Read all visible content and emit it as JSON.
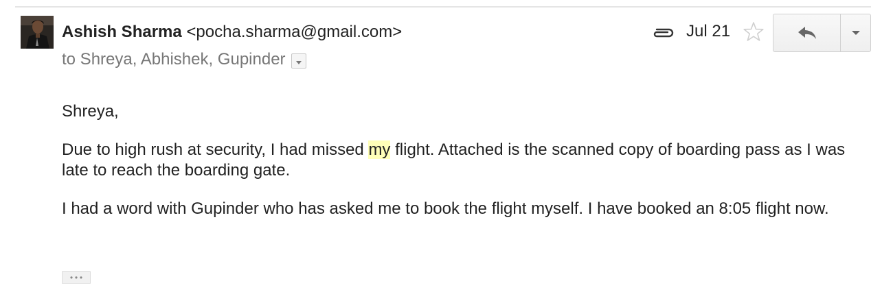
{
  "message": {
    "sender": {
      "name": "Ashish Sharma",
      "email": "<pocha.sharma@gmail.com>"
    },
    "recipients": "to Shreya, Abhishek, Gupinder",
    "date": "Jul 21",
    "has_attachment": true,
    "starred": false,
    "body": {
      "greeting": "Shreya,",
      "paragraph1_before": "Due to high rush at security, I had missed ",
      "paragraph1_highlight": "my",
      "paragraph1_after": " flight. Attached is the scanned copy of boarding pass as I was late to reach the boarding gate.",
      "paragraph2": "I had a word with Gupinder who has asked me to book the flight myself. I have booked an 8:05 flight now."
    }
  },
  "icons": {
    "attachment": "paperclip-icon",
    "star": "star-outline-icon",
    "reply": "reply-arrow-icon",
    "more": "dropdown-caret-icon",
    "details": "details-toggle-icon",
    "trimmed": "ellipsis-icon"
  },
  "colors": {
    "highlight": "#ffffb8",
    "secondary_text": "#777777",
    "primary_text": "#222222"
  }
}
